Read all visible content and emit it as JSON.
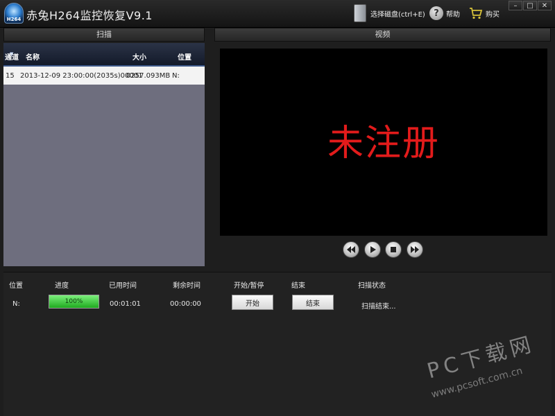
{
  "window": {
    "logo_text": "H264",
    "title": "赤兔H264监控恢复V9.1",
    "select_disk_label": "选择磁盘(ctrl+E)",
    "help_label": "帮助",
    "buy_label": "购买",
    "minimize": "–",
    "maximize": "□",
    "close": "✕"
  },
  "scan": {
    "header": "扫描",
    "columns": [
      "通道",
      "名称",
      "大小",
      "位置"
    ],
    "rows": [
      {
        "channel": "15",
        "name": "2013-12-09 23:00:00(2035s)00001",
        "size": "0257.093MB",
        "location": "N:"
      }
    ]
  },
  "video": {
    "header": "视频",
    "overlay_text": "未注册",
    "overlay_color": "#e21b1b"
  },
  "status": {
    "headers": [
      "位置",
      "进度",
      "已用时间",
      "剩余时间",
      "开始/暂停",
      "结束",
      "扫描状态"
    ],
    "location": "N:",
    "progress_percent": 100,
    "progress_label": "100%",
    "elapsed": "00:01:01",
    "remaining": "00:00:00",
    "start_label": "开始",
    "end_label": "结束",
    "scan_state": "扫描结束..."
  },
  "watermark": {
    "big": "PC下载网",
    "small": "www.pcsoft.com.cn"
  },
  "icons": [
    "app-logo",
    "disk-icon",
    "help-icon",
    "cart-icon",
    "rewind-icon",
    "play-icon",
    "stop-icon",
    "forward-icon"
  ],
  "colors": {
    "progress_green": "#1faa1f",
    "header_blue": "#3e5b8c"
  }
}
